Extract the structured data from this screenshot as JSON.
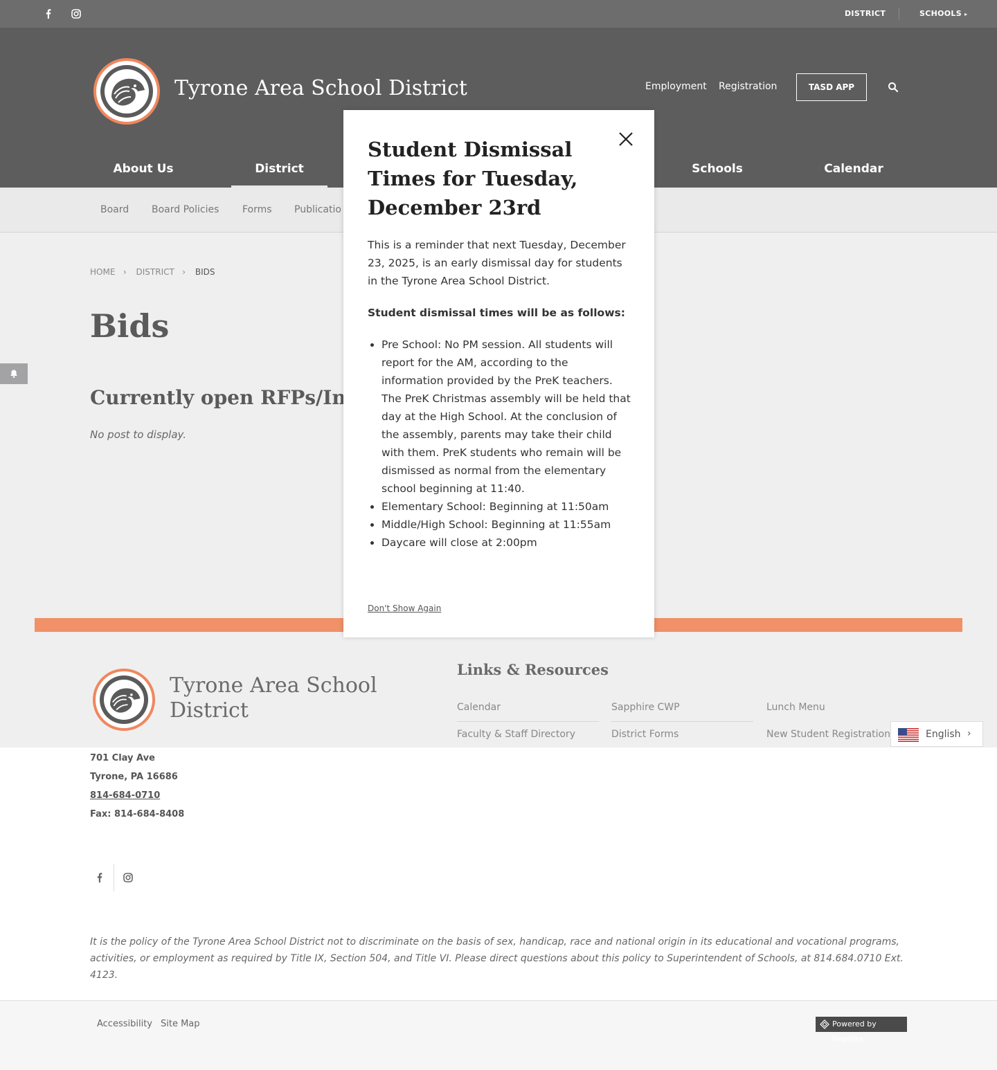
{
  "utility": {
    "district_label": "DISTRICT",
    "schools_label": "SCHOOLS",
    "icons": [
      "facebook-icon",
      "instagram-icon"
    ]
  },
  "header": {
    "site_title": "Tyrone Area School District",
    "links": [
      "Employment",
      "Registration"
    ],
    "app_button": "TASD APP",
    "nav": [
      "About Us",
      "District",
      "Schools",
      "Calendar"
    ],
    "active_nav": "District"
  },
  "subnav": {
    "items": [
      "Board",
      "Board Policies",
      "Forms",
      "Publicatio"
    ]
  },
  "breadcrumb": [
    "HOME",
    "DISTRICT",
    "BIDS"
  ],
  "main": {
    "page_title": "Bids",
    "section_title": "Currently open RFPs/Invi",
    "empty_text": "No post to display."
  },
  "modal": {
    "title": "Student Dismissal Times for Tuesday, December 23rd",
    "intro": "This is a reminder that next Tuesday, December 23, 2025, is an early dismissal day for students in the Tyrone Area School District.",
    "subheading": "Student dismissal times will be as follows:",
    "items": [
      "Pre School:  No PM session.  All students will report for the AM, according to the information provided by the PreK teachers.  The PreK Christmas assembly will be held that day at the High School.  At the conclusion of the assembly, parents may take their child with them.  PreK students who remain will be dismissed as normal from the elementary school beginning at 11:40.",
      "Elementary School:  Beginning at 11:50am",
      "Middle/High School:  Beginning at 11:55am",
      "Daycare will close at 2:00pm"
    ],
    "dont_show": "Don't Show Again"
  },
  "footer": {
    "title": "Tyrone Area School District",
    "links_title": "Links & Resources",
    "links": [
      "Calendar",
      "Sapphire CWP",
      "Lunch Menu",
      "Faculty & Staff Directory",
      "District Forms",
      "New Student Registration"
    ],
    "address_line1": "701 Clay Ave",
    "address_line2": "Tyrone, PA  16686",
    "phone": "814-684-0710",
    "fax": "Fax: 814-684-8408",
    "policy": "It is the policy of the Tyrone Area School District not to discriminate on the basis of sex, handicap, race and national origin in its educational and vocational programs, activities, or employment as required by Title IX, Section 504, and Title VI.  Please direct questions about this policy to  Superintendent of Schools, at 814.684.0710 Ext. 4123.",
    "bottom_links": [
      "Accessibility",
      "Site Map"
    ],
    "powered": "Powered by Finalsite"
  },
  "language": {
    "selected": "English"
  },
  "colors": {
    "accent": "#f09168",
    "header_bg": "#5d5d5e",
    "utility_bg": "#6d6d6e"
  }
}
